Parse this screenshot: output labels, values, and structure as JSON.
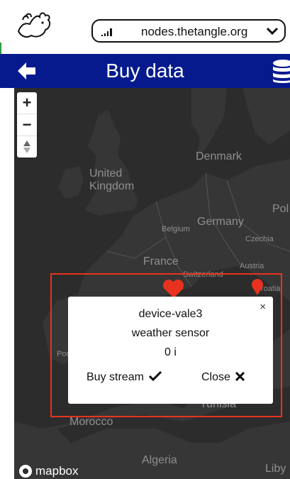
{
  "browser": {
    "url": "nodes.thetangle.org",
    "logo_icon": "flying-pig-logo-icon"
  },
  "header": {
    "title": "Buy data",
    "back_icon": "arrow-left-icon",
    "db_icon": "database-icon",
    "background": "#061a8e"
  },
  "map": {
    "zoom_in_label": "+",
    "zoom_out_label": "−",
    "labels": {
      "united_kingdom": "United\nKingdom",
      "denmark": "Denmark",
      "germany": "Germany",
      "belgium": "Belgium",
      "czechia": "Czechia",
      "pol": "Pol",
      "france": "France",
      "switzerland": "Switzerland",
      "austria": "Austria",
      "croatia": "roatia",
      "por": "Por",
      "tunisia": "Tunisia",
      "morocco": "Morocco",
      "algeria": "Algeria",
      "libya": "Liby"
    },
    "attribution": "mapbox",
    "highlight_color": "#e8321f",
    "marker_color": "#e8321f"
  },
  "popup": {
    "device_name": "device-vale3",
    "device_type": "weather sensor",
    "price": "0 i",
    "buy_label": "Buy stream",
    "close_label": "Close",
    "close_x": "×"
  }
}
